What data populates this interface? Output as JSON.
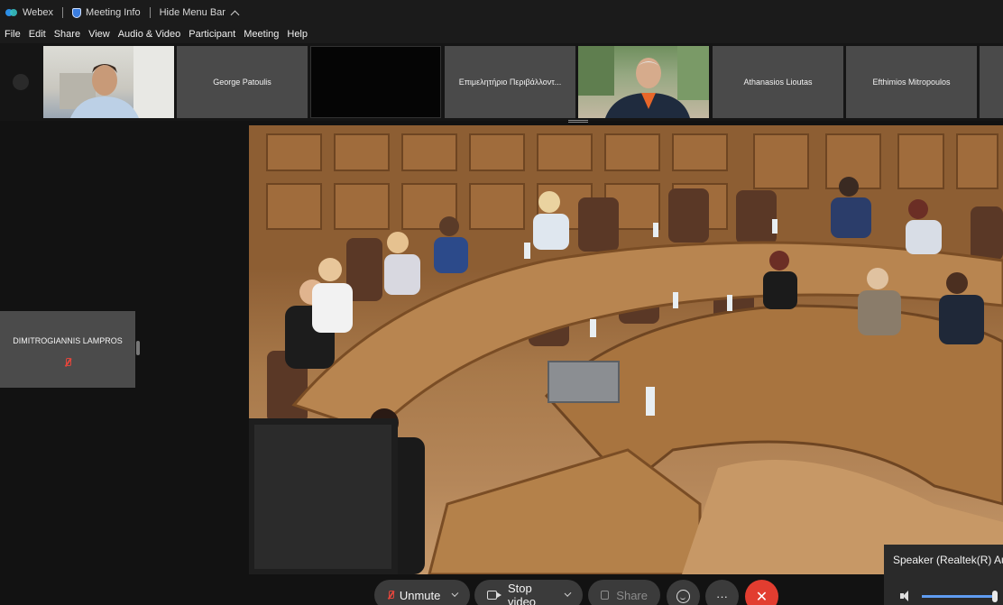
{
  "titlebar": {
    "app_name": "Webex",
    "meeting_info": "Meeting Info",
    "hide_menu": "Hide Menu Bar"
  },
  "menu": [
    "File",
    "Edit",
    "Share",
    "View",
    "Audio & Video",
    "Participant",
    "Meeting",
    "Help"
  ],
  "thumbnails": [
    {
      "name": "",
      "type": "video"
    },
    {
      "name": "George Patoulis",
      "type": "name"
    },
    {
      "name": "",
      "type": "black"
    },
    {
      "name": "Επιμελητήριο Περιβάλλοντ...",
      "type": "name"
    },
    {
      "name": "",
      "type": "video"
    },
    {
      "name": "Athanasios Lioutas",
      "type": "name"
    },
    {
      "name": "Efthimios Mitropoulos",
      "type": "name"
    }
  ],
  "side_participant": {
    "name": "DIMITROGIANNIS LAMPROS",
    "muted": true
  },
  "controls": {
    "unmute": "Unmute",
    "stop_video": "Stop video",
    "share": "Share",
    "more": "···",
    "leave": "✕"
  },
  "speaker_panel": {
    "label": "Speaker (Realtek(R) Au",
    "volume_fraction": 0.95
  },
  "colors": {
    "leave_red": "#e23d30",
    "accent_blue": "#5f9cf0",
    "muted_red": "#e0463c"
  }
}
